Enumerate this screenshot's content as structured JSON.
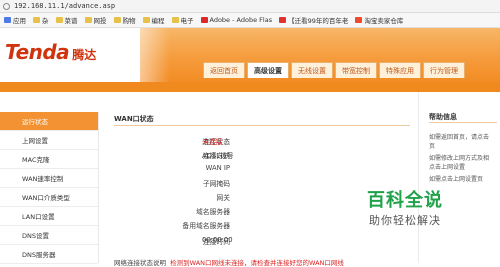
{
  "browser": {
    "url": "192.168.11.1/advance.asp"
  },
  "bookmarks": [
    {
      "label": "应用",
      "icon": "apps-icon"
    },
    {
      "label": "杂",
      "icon": "folder-icon"
    },
    {
      "label": "菜谱",
      "icon": "folder-icon"
    },
    {
      "label": "网投",
      "icon": "folder-icon"
    },
    {
      "label": "购物",
      "icon": "folder-icon"
    },
    {
      "label": "编程",
      "icon": "folder-icon"
    },
    {
      "label": "电子",
      "icon": "folder-icon"
    },
    {
      "label": "Adobe - Adobe Flas",
      "icon": "adobe-icon"
    },
    {
      "label": "【迁看99年的百年老",
      "icon": "site-icon"
    },
    {
      "label": "淘宝卖家仓库",
      "icon": "taobao-icon"
    }
  ],
  "header": {
    "brand": "Tenda",
    "brand_cn": "腾达",
    "tabs": [
      {
        "label": "返回首页",
        "active": false
      },
      {
        "label": "高级设置",
        "active": true
      },
      {
        "label": "无线设置",
        "active": false
      },
      {
        "label": "带宽控制",
        "active": false
      },
      {
        "label": "特殊应用",
        "active": false
      },
      {
        "label": "行为管理",
        "active": false
      }
    ]
  },
  "sidebar": {
    "items": [
      {
        "label": "运行状态",
        "active": true
      },
      {
        "label": "上网设置",
        "active": false
      },
      {
        "label": "MAC克隆",
        "active": false
      },
      {
        "label": "WAN速率控制",
        "active": false
      },
      {
        "label": "WAN口介质类型",
        "active": false
      },
      {
        "label": "LAN口设置",
        "active": false
      },
      {
        "label": "DNS设置",
        "active": false
      },
      {
        "label": "DNS服务器",
        "active": false
      }
    ]
  },
  "main": {
    "title": "WAN口状态",
    "rows": [
      {
        "label": "连接状态",
        "value": "未连接",
        "highlight": true
      },
      {
        "label": "连接方式",
        "value": "ADSL拨号",
        "highlight": false
      },
      {
        "label": "WAN IP",
        "value": "",
        "highlight": false
      },
      {
        "label": "子网掩码",
        "value": "",
        "highlight": false
      },
      {
        "label": "网关",
        "value": "",
        "highlight": false
      },
      {
        "label": "域名服务器",
        "value": "",
        "highlight": false
      },
      {
        "label": "备用域名服务器",
        "value": "",
        "highlight": false
      },
      {
        "label": "连接时间",
        "value": "00:00:00",
        "highlight": false
      }
    ],
    "footnote_label": "网络连接状态说明",
    "footnote_text": "检测到WAN口网线未连接，请检查并连接好您的WAN口网线"
  },
  "help": {
    "title": "帮助信息",
    "lines": [
      "如需返回首页，请点击",
      "页",
      "如需修改上网方式及相",
      "点击上网设置",
      "如需点击上网设置页"
    ]
  },
  "watermark": {
    "title": "百科全说",
    "subtitle": "助你轻松解决"
  },
  "colors": {
    "accent": "#f08a1e",
    "brand": "#d0340f",
    "alert": "#dd2222",
    "watermark": "#1fa24a"
  }
}
